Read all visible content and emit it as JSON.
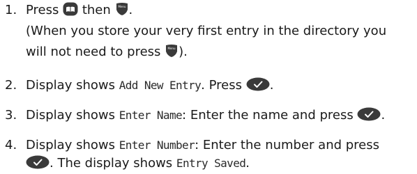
{
  "steps": [
    {
      "number": "1.",
      "parts": {
        "a": "Press",
        "b": "then",
        "c": "."
      },
      "line2": "(When you store your very first entry in the directory you",
      "line3a": "will not need to press",
      "line3b": ")."
    },
    {
      "number": "2.",
      "a": "Display shows",
      "lcd": "Add New Entry",
      "b": ". Press",
      "c": "."
    },
    {
      "number": "3.",
      "a": "Display shows",
      "lcd": "Enter Name",
      "b": ": Enter the name and press",
      "c": "."
    },
    {
      "number": "4.",
      "a": "Display shows",
      "lcd": "Enter Number",
      "b": ": Enter the number and press",
      "line2b": ". The display shows",
      "lcd2": "Entry Saved",
      "line2c": "."
    }
  ],
  "icons": {
    "directory": "phonebook-icon",
    "menu": "menu-key-icon",
    "menu_label": "Menu",
    "ok": "ok-checkmark-key-icon"
  },
  "colors": {
    "key": "#3a3a3a",
    "check": "#ffffff",
    "text": "#1a1a1a"
  }
}
